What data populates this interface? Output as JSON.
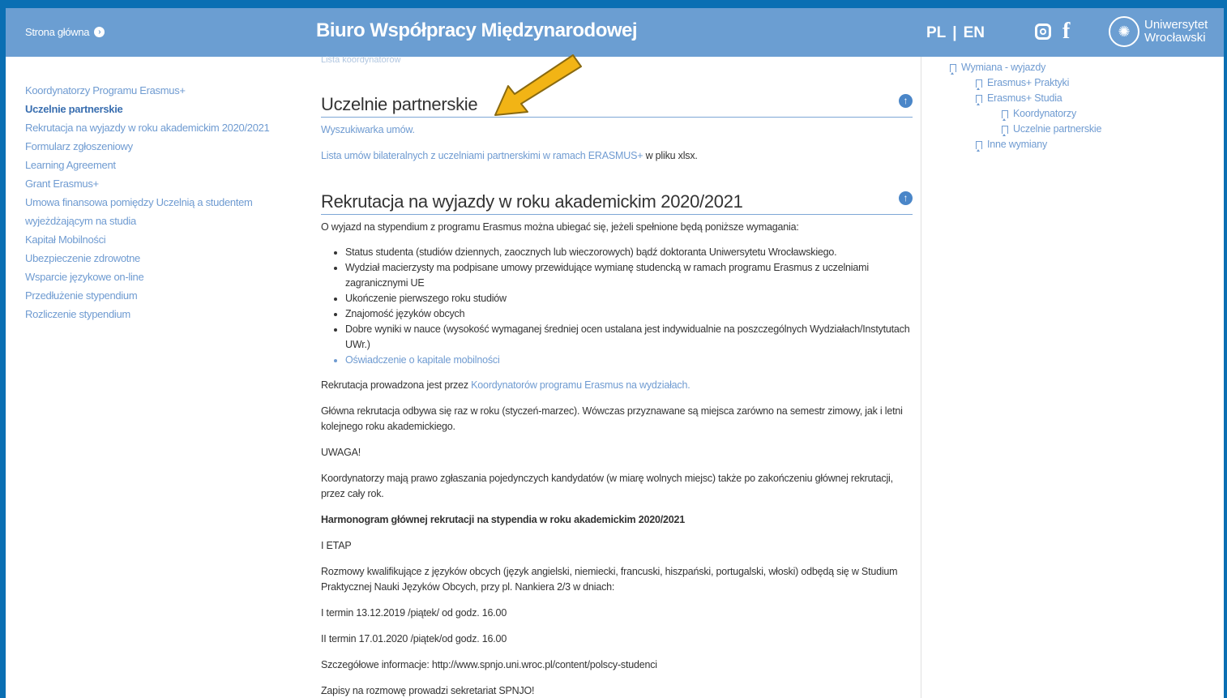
{
  "header": {
    "home_label": "Strona główna",
    "site_title": "Biuro Współpracy Międzynarodowej",
    "lang_pl": "PL",
    "lang_sep": "|",
    "lang_en": "EN",
    "uni_line1": "Uniwersytet",
    "uni_line2": "Wrocławski"
  },
  "left_nav": [
    {
      "label": "Koordynatorzy Programu Erasmus+",
      "active": false
    },
    {
      "label": "Uczelnie partnerskie",
      "active": true
    },
    {
      "label": "Rekrutacja na wyjazdy w roku akademickim 2020/2021",
      "active": false
    },
    {
      "label": "Formularz zgłoszeniowy",
      "active": false
    },
    {
      "label": "Learning Agreement",
      "active": false
    },
    {
      "label": "Grant Erasmus+",
      "active": false
    },
    {
      "label": "Umowa finansowa pomiędzy Uczelnią a studentem",
      "active": false
    },
    {
      "label": "wyjeżdżającym na studia",
      "active": false
    },
    {
      "label": "Kapitał Mobilności",
      "active": false
    },
    {
      "label": "Ubezpieczenie zdrowotne",
      "active": false
    },
    {
      "label": "Wsparcie językowe on-line",
      "active": false
    },
    {
      "label": "Przedłużenie stypendium",
      "active": false
    },
    {
      "label": "Rozliczenie stypendium",
      "active": false
    }
  ],
  "main": {
    "cut_text": "Lista koordynatorów",
    "sec1_title": "Uczelnie partnerskie",
    "sec1_link1": "Wyszukiwarka umów.",
    "sec1_link2": "Lista umów bilateralnych z uczelniami partnerskimi w ramach ERASMUS+",
    "sec1_link2_suffix": " w pliku xlsx.",
    "sec2_title": "Rekrutacja na wyjazdy w roku akademickim 2020/2021",
    "intro": "O wyjazd na stypendium z programu Erasmus można ubiegać się, jeżeli spełnione będą poniższe wymagania:",
    "bullets": [
      "Status studenta (studiów dziennych, zaocznych lub wieczorowych) bądź doktoranta Uniwersytetu Wrocławskiego.",
      "Wydział macierzysty ma podpisane umowy przewidujące wymianę studencką w ramach programu Erasmus z uczelniami zagranicznymi UE",
      "Ukończenie pierwszego roku studiów",
      "Znajomość języków obcych",
      "Dobre wyniki w nauce (wysokość wymaganej średniej ocen ustalana jest indywidualnie na poszczególnych Wydziałach/Instytutach UWr.)",
      "Oświadczenie o kapitale mobilności"
    ],
    "recruit_prefix": "Rekrutacja prowadzona jest przez ",
    "recruit_link": "Koordynatorów programu Erasmus na wydziałach.",
    "main_recruit": "Główna rekrutacja odbywa się raz w roku (styczeń-marzec). Wówczas przyznawane są miejsca zarówno na semestr zimowy, jak i letni kolejnego roku akademickiego.",
    "uwaga": "UWAGA!",
    "coord_note": "Koordynatorzy mają prawo zgłaszania pojedynczych kandydatów (w miarę wolnych miejsc) także po zakończeniu głównej rekrutacji, przez cały rok.",
    "schedule_title": "Harmonogram głównej rekrutacji na stypendia w roku akademickim 2020/2021",
    "etap": "I ETAP",
    "interviews": "Rozmowy kwalifikujące z języków obcych (język angielski, niemiecki, francuski, hiszpański, portugalski, włoski) odbędą się w Studium Praktycznej Nauki Języków Obcych, przy pl. Nankiera 2/3 w dniach:",
    "term1": "I termin 13.12.2019 /piątek/ od godz. 16.00",
    "term2": "II termin 17.01.2020 /piątek/od godz. 16.00",
    "details": "Szczegółowe informacje: http://www.spnjo.uni.wroc.pl/content/polscy-studenci",
    "signup": "Zapisy na rozmowę prowadzi sekretariat SPNJO!"
  },
  "right_nav": [
    {
      "label": "Wymiana - wyjazdy",
      "level": 0
    },
    {
      "label": "Erasmus+ Praktyki",
      "level": 1
    },
    {
      "label": "Erasmus+ Studia",
      "level": 1
    },
    {
      "label": "Koordynatorzy",
      "level": 2
    },
    {
      "label": "Uczelnie partnerskie",
      "level": 2
    },
    {
      "label": "Inne wymiany",
      "level": 1
    }
  ],
  "colors": {
    "header": "#6b9ed2",
    "link": "#6f9bd1",
    "arrow": "#f2b415",
    "outer_border": "#0a6fb3"
  }
}
